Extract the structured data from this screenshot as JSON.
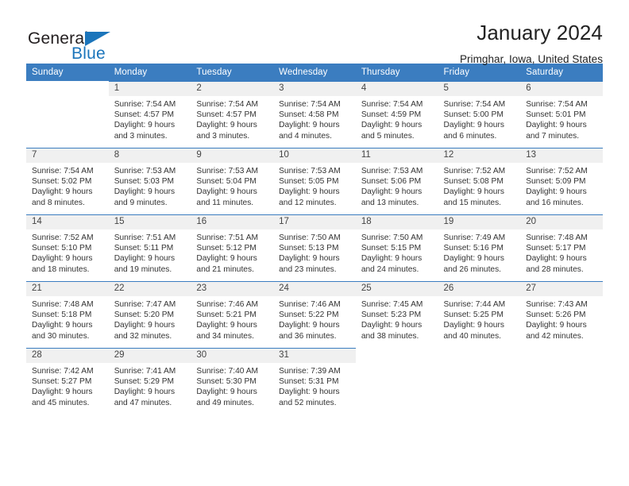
{
  "brand": {
    "word1": "General",
    "word2": "Blue",
    "triangle_color": "#1b75bb",
    "icon": "triangle-icon"
  },
  "header": {
    "title": "January 2024",
    "subtitle": "Primghar, Iowa, United States"
  },
  "theme": {
    "header_bg": "#3b7dc0",
    "daynum_bg": "#f0f0f0",
    "text": "#333333",
    "accent": "#1b75bb"
  },
  "calendar": {
    "weekday_headers": [
      "Sunday",
      "Monday",
      "Tuesday",
      "Wednesday",
      "Thursday",
      "Friday",
      "Saturday"
    ],
    "labels": {
      "sunrise": "Sunrise:",
      "sunset": "Sunset:",
      "daylight": "Daylight:"
    },
    "weeks": [
      [
        {
          "day": "",
          "sunrise": "",
          "sunset": "",
          "daylight_line1": "",
          "daylight_line2": ""
        },
        {
          "day": "1",
          "sunrise": "Sunrise: 7:54 AM",
          "sunset": "Sunset: 4:57 PM",
          "daylight_line1": "Daylight: 9 hours",
          "daylight_line2": "and 3 minutes."
        },
        {
          "day": "2",
          "sunrise": "Sunrise: 7:54 AM",
          "sunset": "Sunset: 4:57 PM",
          "daylight_line1": "Daylight: 9 hours",
          "daylight_line2": "and 3 minutes."
        },
        {
          "day": "3",
          "sunrise": "Sunrise: 7:54 AM",
          "sunset": "Sunset: 4:58 PM",
          "daylight_line1": "Daylight: 9 hours",
          "daylight_line2": "and 4 minutes."
        },
        {
          "day": "4",
          "sunrise": "Sunrise: 7:54 AM",
          "sunset": "Sunset: 4:59 PM",
          "daylight_line1": "Daylight: 9 hours",
          "daylight_line2": "and 5 minutes."
        },
        {
          "day": "5",
          "sunrise": "Sunrise: 7:54 AM",
          "sunset": "Sunset: 5:00 PM",
          "daylight_line1": "Daylight: 9 hours",
          "daylight_line2": "and 6 minutes."
        },
        {
          "day": "6",
          "sunrise": "Sunrise: 7:54 AM",
          "sunset": "Sunset: 5:01 PM",
          "daylight_line1": "Daylight: 9 hours",
          "daylight_line2": "and 7 minutes."
        }
      ],
      [
        {
          "day": "7",
          "sunrise": "Sunrise: 7:54 AM",
          "sunset": "Sunset: 5:02 PM",
          "daylight_line1": "Daylight: 9 hours",
          "daylight_line2": "and 8 minutes."
        },
        {
          "day": "8",
          "sunrise": "Sunrise: 7:53 AM",
          "sunset": "Sunset: 5:03 PM",
          "daylight_line1": "Daylight: 9 hours",
          "daylight_line2": "and 9 minutes."
        },
        {
          "day": "9",
          "sunrise": "Sunrise: 7:53 AM",
          "sunset": "Sunset: 5:04 PM",
          "daylight_line1": "Daylight: 9 hours",
          "daylight_line2": "and 11 minutes."
        },
        {
          "day": "10",
          "sunrise": "Sunrise: 7:53 AM",
          "sunset": "Sunset: 5:05 PM",
          "daylight_line1": "Daylight: 9 hours",
          "daylight_line2": "and 12 minutes."
        },
        {
          "day": "11",
          "sunrise": "Sunrise: 7:53 AM",
          "sunset": "Sunset: 5:06 PM",
          "daylight_line1": "Daylight: 9 hours",
          "daylight_line2": "and 13 minutes."
        },
        {
          "day": "12",
          "sunrise": "Sunrise: 7:52 AM",
          "sunset": "Sunset: 5:08 PM",
          "daylight_line1": "Daylight: 9 hours",
          "daylight_line2": "and 15 minutes."
        },
        {
          "day": "13",
          "sunrise": "Sunrise: 7:52 AM",
          "sunset": "Sunset: 5:09 PM",
          "daylight_line1": "Daylight: 9 hours",
          "daylight_line2": "and 16 minutes."
        }
      ],
      [
        {
          "day": "14",
          "sunrise": "Sunrise: 7:52 AM",
          "sunset": "Sunset: 5:10 PM",
          "daylight_line1": "Daylight: 9 hours",
          "daylight_line2": "and 18 minutes."
        },
        {
          "day": "15",
          "sunrise": "Sunrise: 7:51 AM",
          "sunset": "Sunset: 5:11 PM",
          "daylight_line1": "Daylight: 9 hours",
          "daylight_line2": "and 19 minutes."
        },
        {
          "day": "16",
          "sunrise": "Sunrise: 7:51 AM",
          "sunset": "Sunset: 5:12 PM",
          "daylight_line1": "Daylight: 9 hours",
          "daylight_line2": "and 21 minutes."
        },
        {
          "day": "17",
          "sunrise": "Sunrise: 7:50 AM",
          "sunset": "Sunset: 5:13 PM",
          "daylight_line1": "Daylight: 9 hours",
          "daylight_line2": "and 23 minutes."
        },
        {
          "day": "18",
          "sunrise": "Sunrise: 7:50 AM",
          "sunset": "Sunset: 5:15 PM",
          "daylight_line1": "Daylight: 9 hours",
          "daylight_line2": "and 24 minutes."
        },
        {
          "day": "19",
          "sunrise": "Sunrise: 7:49 AM",
          "sunset": "Sunset: 5:16 PM",
          "daylight_line1": "Daylight: 9 hours",
          "daylight_line2": "and 26 minutes."
        },
        {
          "day": "20",
          "sunrise": "Sunrise: 7:48 AM",
          "sunset": "Sunset: 5:17 PM",
          "daylight_line1": "Daylight: 9 hours",
          "daylight_line2": "and 28 minutes."
        }
      ],
      [
        {
          "day": "21",
          "sunrise": "Sunrise: 7:48 AM",
          "sunset": "Sunset: 5:18 PM",
          "daylight_line1": "Daylight: 9 hours",
          "daylight_line2": "and 30 minutes."
        },
        {
          "day": "22",
          "sunrise": "Sunrise: 7:47 AM",
          "sunset": "Sunset: 5:20 PM",
          "daylight_line1": "Daylight: 9 hours",
          "daylight_line2": "and 32 minutes."
        },
        {
          "day": "23",
          "sunrise": "Sunrise: 7:46 AM",
          "sunset": "Sunset: 5:21 PM",
          "daylight_line1": "Daylight: 9 hours",
          "daylight_line2": "and 34 minutes."
        },
        {
          "day": "24",
          "sunrise": "Sunrise: 7:46 AM",
          "sunset": "Sunset: 5:22 PM",
          "daylight_line1": "Daylight: 9 hours",
          "daylight_line2": "and 36 minutes."
        },
        {
          "day": "25",
          "sunrise": "Sunrise: 7:45 AM",
          "sunset": "Sunset: 5:23 PM",
          "daylight_line1": "Daylight: 9 hours",
          "daylight_line2": "and 38 minutes."
        },
        {
          "day": "26",
          "sunrise": "Sunrise: 7:44 AM",
          "sunset": "Sunset: 5:25 PM",
          "daylight_line1": "Daylight: 9 hours",
          "daylight_line2": "and 40 minutes."
        },
        {
          "day": "27",
          "sunrise": "Sunrise: 7:43 AM",
          "sunset": "Sunset: 5:26 PM",
          "daylight_line1": "Daylight: 9 hours",
          "daylight_line2": "and 42 minutes."
        }
      ],
      [
        {
          "day": "28",
          "sunrise": "Sunrise: 7:42 AM",
          "sunset": "Sunset: 5:27 PM",
          "daylight_line1": "Daylight: 9 hours",
          "daylight_line2": "and 45 minutes."
        },
        {
          "day": "29",
          "sunrise": "Sunrise: 7:41 AM",
          "sunset": "Sunset: 5:29 PM",
          "daylight_line1": "Daylight: 9 hours",
          "daylight_line2": "and 47 minutes."
        },
        {
          "day": "30",
          "sunrise": "Sunrise: 7:40 AM",
          "sunset": "Sunset: 5:30 PM",
          "daylight_line1": "Daylight: 9 hours",
          "daylight_line2": "and 49 minutes."
        },
        {
          "day": "31",
          "sunrise": "Sunrise: 7:39 AM",
          "sunset": "Sunset: 5:31 PM",
          "daylight_line1": "Daylight: 9 hours",
          "daylight_line2": "and 52 minutes."
        },
        {
          "day": "",
          "sunrise": "",
          "sunset": "",
          "daylight_line1": "",
          "daylight_line2": ""
        },
        {
          "day": "",
          "sunrise": "",
          "sunset": "",
          "daylight_line1": "",
          "daylight_line2": ""
        },
        {
          "day": "",
          "sunrise": "",
          "sunset": "",
          "daylight_line1": "",
          "daylight_line2": ""
        }
      ]
    ]
  }
}
